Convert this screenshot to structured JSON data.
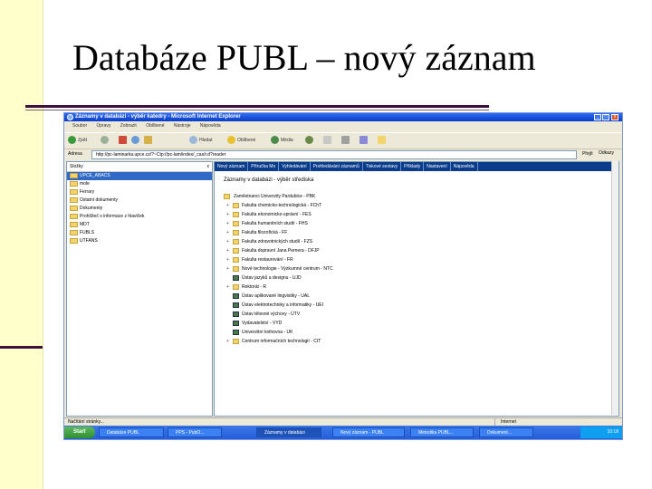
{
  "slide": {
    "title": "Databáze PUBL – nový záznam"
  },
  "window": {
    "title": "Záznamy v databázi - výběr katedry - Microsoft Internet Explorer",
    "controls": [
      "_",
      "□",
      "x"
    ]
  },
  "menu": [
    "Soubor",
    "Úpravy",
    "Zobrazit",
    "Oblíbené",
    "Nástroje",
    "Nápověda"
  ],
  "toolbar": {
    "back": "Zpět",
    "search": "Hledat",
    "favorites": "Oblíbené",
    "media": "Média"
  },
  "address": {
    "label": "Adresa",
    "url": "http://pc-laminarka.upce.cz/?~Ctp://pc-lam/index/_cas/r.d?reader",
    "go": "Přejít",
    "links": "Odkazy"
  },
  "left_pane": {
    "title": "Složky",
    "close": "x",
    "items": [
      {
        "label": "UPCE_ABACS",
        "selected": true
      },
      {
        "label": "mole",
        "selected": false
      },
      {
        "label": "Ferrary",
        "selected": false
      },
      {
        "label": "Ostatní dokumenty",
        "selected": false
      },
      {
        "label": "Dokumenty",
        "selected": false
      },
      {
        "label": "Prohlížeč s informace z hlaviček",
        "selected": false
      },
      {
        "label": "MDT",
        "selected": false
      },
      {
        "label": "FUBLS",
        "selected": false
      },
      {
        "label": "UTFANS",
        "selected": false
      }
    ]
  },
  "content": {
    "nav": [
      "Nový záznam",
      "Příručka Mo",
      "Vyhledávání",
      "Prohledávání záznamů",
      "Tiskové sestavy",
      "Příklady",
      "Nastavení",
      "Nápověda"
    ],
    "heading": "Záznamy v databázi - výběr střediska",
    "root": "Zaměstnanci Univerzity Pardubice - PBK",
    "tree": [
      {
        "label": "Fakulta chemicko-technologická - FChT",
        "kind": "folder"
      },
      {
        "label": "Fakulta ekonomicko-správní - FES",
        "kind": "folder"
      },
      {
        "label": "Fakulta humanitních studií - FHS",
        "kind": "folder"
      },
      {
        "label": "Fakulta filozofická - FF",
        "kind": "folder"
      },
      {
        "label": "Fakulta zdravotnických studií - FZS",
        "kind": "folder"
      },
      {
        "label": "Fakulta dopravní Jana Pernera - DFJP",
        "kind": "folder"
      },
      {
        "label": "Fakulta restaurování - FR",
        "kind": "folder"
      },
      {
        "label": "Nové technologie - Výzkumné centrum - NTC",
        "kind": "folder"
      },
      {
        "label": "Ústav jazyků a designu - UJD",
        "kind": "book"
      },
      {
        "label": "Rektorát - R",
        "kind": "folder"
      },
      {
        "label": "Ústav aplikované lingvistiky - UAL",
        "kind": "book"
      },
      {
        "label": "Ústav elektrotechniky a informatiky - UEI",
        "kind": "book"
      },
      {
        "label": "Ústav tělesné výchovy - ÚTV",
        "kind": "book"
      },
      {
        "label": "Vydavatelství - VYD",
        "kind": "book"
      },
      {
        "label": "Univerzitní knihovna - UK",
        "kind": "book"
      },
      {
        "label": "Centrum informačních technologií - CIT",
        "kind": "folder"
      }
    ]
  },
  "status": {
    "left": "Načítání stránky...",
    "zone": "Internet"
  },
  "taskbar": {
    "start": "Start",
    "tasks": [
      "Databáze PUBL",
      "PPS - PubO...",
      "Záznamy v databázi",
      "Nový záznam - PUBL",
      "Metodika PUBL...",
      "Dokument..."
    ],
    "clock": "10:18"
  },
  "colors": {
    "slide_band": "#ffffcc",
    "rule": "#3f0f3f",
    "xp_blue": "#0a3cc8",
    "nav_blue": "#0a3c8c"
  }
}
